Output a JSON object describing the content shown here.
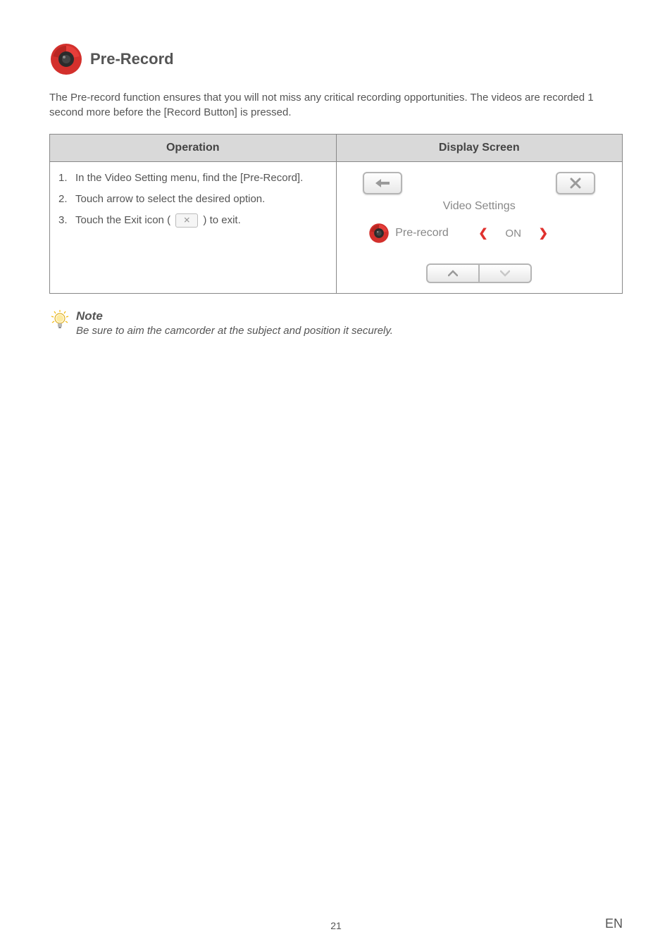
{
  "section": {
    "title": "Pre-Record",
    "intro": "The Pre-record function ensures that you will not miss any critical recording opportunities. The videos are recorded 1 second more before the [Record Button] is pressed."
  },
  "table": {
    "headers": {
      "operation": "Operation",
      "display": "Display Screen"
    },
    "operations": [
      {
        "num": "1.",
        "text": "In the Video Setting menu, find the [Pre-Record]."
      },
      {
        "num": "2.",
        "text": "Touch arrow to select the desired option."
      },
      {
        "num": "3.",
        "text_before": "Touch the Exit icon (",
        "text_after": ") to exit."
      }
    ]
  },
  "screen": {
    "title": "Video Settings",
    "setting_label": "Pre-record",
    "setting_value": "ON"
  },
  "note": {
    "title": "Note",
    "text": "Be sure to aim the camcorder at the subject and position it securely."
  },
  "footer": {
    "page": "21",
    "lang": "EN"
  }
}
